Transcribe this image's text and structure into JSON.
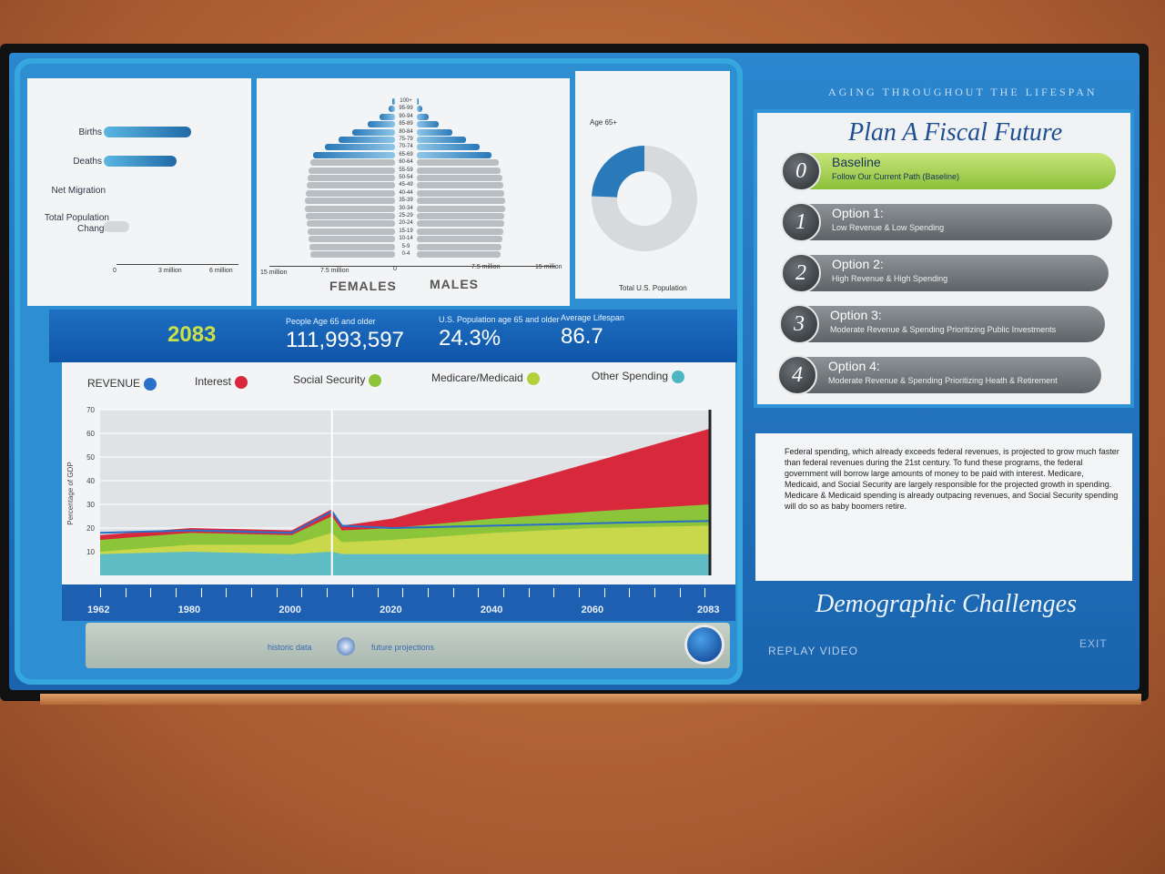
{
  "vitals": {
    "rows": [
      "Births",
      "Deaths",
      "Net Migration",
      "Total Population Change"
    ],
    "bar_values_millions": [
      4.3,
      3.6,
      0,
      0
    ],
    "axis_ticks": [
      "0",
      "3 million",
      "6 million"
    ]
  },
  "pyramid": {
    "ages": [
      "100+",
      "95-99",
      "90-94",
      "85-89",
      "80-84",
      "75-79",
      "70-74",
      "65-69",
      "60-64",
      "55-59",
      "50-54",
      "45-49",
      "40-44",
      "35-39",
      "30-34",
      "25-29",
      "20-24",
      "15-19",
      "10-14",
      "5-9",
      "0-4"
    ],
    "female_values_millions": [
      0.3,
      0.8,
      1.8,
      3.2,
      5.0,
      6.6,
      8.2,
      9.6,
      10.0,
      10.2,
      10.3,
      10.4,
      10.5,
      10.6,
      10.6,
      10.5,
      10.4,
      10.3,
      10.2,
      10.1,
      10.0
    ],
    "male_values_millions": [
      0.2,
      0.6,
      1.4,
      2.6,
      4.2,
      5.8,
      7.4,
      8.8,
      9.6,
      9.9,
      10.1,
      10.2,
      10.3,
      10.4,
      10.4,
      10.3,
      10.3,
      10.2,
      10.1,
      10.0,
      9.9
    ],
    "axis_left": [
      "15 million",
      "7.5 million",
      "0"
    ],
    "axis_right": [
      "7.5 million",
      "15 million"
    ],
    "females_label": "FEMALES",
    "males_label": "MALES"
  },
  "donut": {
    "label_top": "Age 65+",
    "label_bottom": "Total U.S. Population",
    "fraction": 0.243
  },
  "stats": {
    "year": "2083",
    "people_label": "People Age 65 and older",
    "people_value": "111,993,597",
    "pct_label": "U.S. Population age 65 and older",
    "pct_value": "24.3%",
    "life_label": "Average Lifespan",
    "life_value": "86.7"
  },
  "legend": [
    {
      "label": "REVENUE",
      "color": "#2a6fc9"
    },
    {
      "label": "Interest",
      "color": "#d8283c"
    },
    {
      "label": "Social Security",
      "color": "#8cc43a"
    },
    {
      "label": "Medicare/Medicaid",
      "color": "#b4cf3a"
    },
    {
      "label": "Other Spending",
      "color": "#4cb6c2"
    }
  ],
  "chart_data": {
    "type": "area",
    "ylabel": "Percentage of GDP",
    "ylim": [
      0,
      70
    ],
    "y_ticks": [
      "70",
      "60",
      "50",
      "40",
      "30",
      "20",
      "10"
    ],
    "x": [
      1962,
      1980,
      2000,
      2008,
      2010,
      2020,
      2040,
      2060,
      2083
    ],
    "series": [
      {
        "name": "Other Spending",
        "values": [
          9,
          10,
          9,
          10,
          9,
          9,
          9,
          9,
          9
        ]
      },
      {
        "name": "Medicare/Medicaid",
        "values": [
          10,
          13,
          13,
          18,
          14,
          15,
          18,
          20,
          21
        ]
      },
      {
        "name": "Social Security",
        "values": [
          15,
          18,
          17,
          25,
          19,
          20,
          24,
          27,
          30
        ]
      },
      {
        "name": "Interest",
        "values": [
          17,
          20,
          19,
          28,
          21,
          24,
          36,
          48,
          62
        ]
      },
      {
        "name": "REVENUE",
        "values": [
          18,
          19,
          18,
          27,
          21,
          20,
          21,
          22,
          23
        ]
      }
    ],
    "x_ticks": [
      "1962",
      "1980",
      "2000",
      "2020",
      "2040",
      "2060",
      "2083"
    ]
  },
  "scrubber": {
    "historic_label": "historic data",
    "future_label": "future projections"
  },
  "right": {
    "header": "AGING THROUGHOUT THE LIFESPAN",
    "plan_title": "Plan A Fiscal Future",
    "options": [
      {
        "num": "0",
        "title": "Baseline",
        "sub": "Follow Our Current Path (Baseline)"
      },
      {
        "num": "1",
        "title": "Option 1:",
        "sub": "Low Revenue & Low Spending"
      },
      {
        "num": "2",
        "title": "Option 2:",
        "sub": "High Revenue & High Spending"
      },
      {
        "num": "3",
        "title": "Option 3:",
        "sub": "Moderate Revenue & Spending Prioritizing Public Investments"
      },
      {
        "num": "4",
        "title": "Option 4:",
        "sub": "Moderate Revenue & Spending Prioritizing Heath & Retirement"
      }
    ],
    "description": "Federal spending, which already exceeds federal revenues, is projected to grow much faster than federal revenues during the 21st century. To fund these programs, the federal government will borrow large amounts of money to be paid with interest. Medicare, Medicaid, and Social Security are largely responsible for the projected growth in spending. Medicare & Medicaid spending is already outpacing revenues, and Social Security spending will do so as baby boomers retire.",
    "section_title": "Demographic Challenges",
    "replay": "REPLAY VIDEO",
    "exit": "EXIT"
  }
}
